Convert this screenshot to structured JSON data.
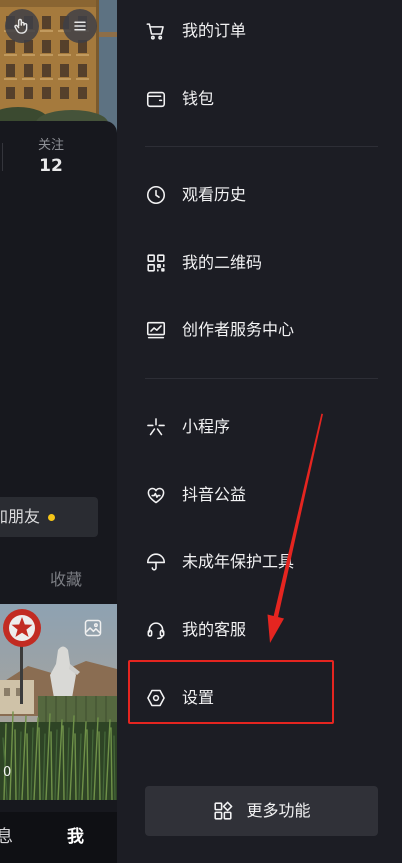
{
  "header": {
    "left_button_icon": "hand-pointer-icon",
    "right_button_icon": "menu-icon"
  },
  "profile": {
    "following_label": "关注",
    "following_count": "12",
    "add_friend_label": "加朋友",
    "favorites_tab": "收藏",
    "thumbnail_badge_icon": "gallery-icon",
    "thumbnail_likes": "0"
  },
  "bottom_nav": {
    "messages": "息",
    "me": "我"
  },
  "drawer": {
    "items": [
      {
        "icon": "cart-icon",
        "label": "我的订单"
      },
      {
        "icon": "wallet-icon",
        "label": "钱包"
      },
      {
        "icon": "clock-icon",
        "label": "观看历史"
      },
      {
        "icon": "qr-code-icon",
        "label": "我的二维码"
      },
      {
        "icon": "creator-chart-icon",
        "label": "创作者服务中心"
      },
      {
        "icon": "mini-program-icon",
        "label": "小程序"
      },
      {
        "icon": "charity-heart-icon",
        "label": "抖音公益"
      },
      {
        "icon": "umbrella-icon",
        "label": "未成年保护工具"
      },
      {
        "icon": "headset-icon",
        "label": "我的客服"
      },
      {
        "icon": "settings-icon",
        "label": "设置"
      }
    ],
    "more_button": {
      "icon": "grid-icon",
      "label": "更多功能"
    }
  },
  "annotation": {
    "color": "#e52520"
  },
  "colors": {
    "drawer_bg": "#1c1d24",
    "button_bg": "#303138",
    "text": "#f2f2f3",
    "muted_text": "#7b7d83",
    "notification_dot": "#f5c518"
  }
}
